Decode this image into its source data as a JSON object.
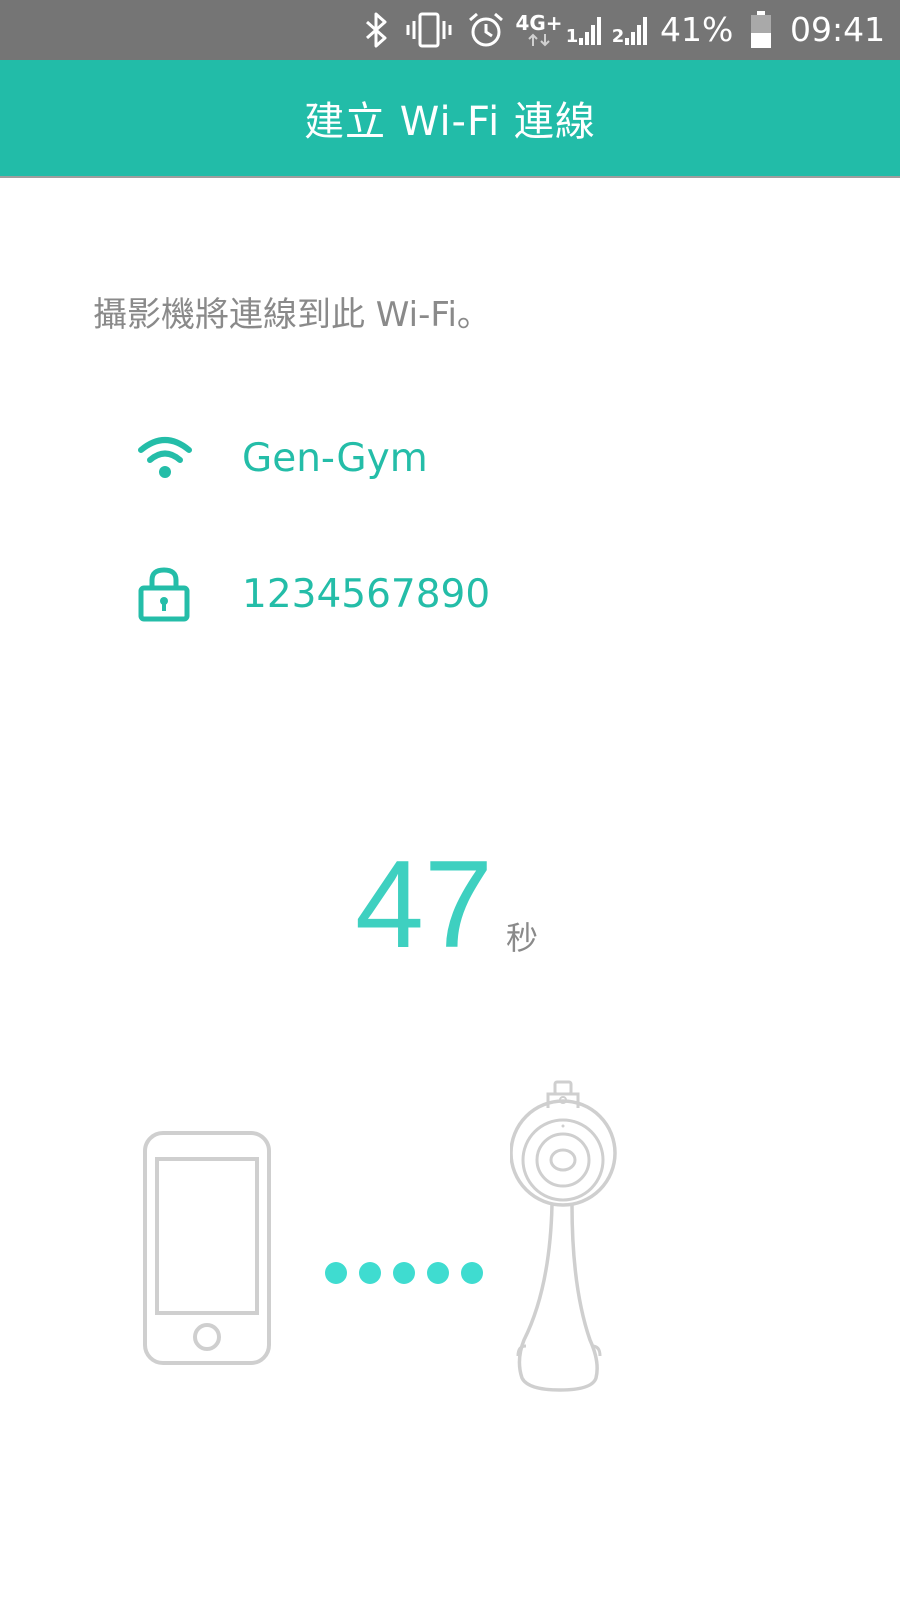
{
  "status_bar": {
    "battery_percent": "41%",
    "time": "09:41",
    "network_type": "4G+",
    "sim1_label": "1",
    "sim2_label": "2",
    "icons": [
      "bluetooth-icon",
      "vibrate-icon",
      "alarm-icon",
      "network-4g-icon",
      "signal-sim1-icon",
      "signal-sim2-icon",
      "battery-icon"
    ]
  },
  "app_bar": {
    "title": "建立 Wi-Fi 連線"
  },
  "main": {
    "description": "攝影機將連線到此 Wi-Fi。",
    "network_name": "Gen-Gym",
    "network_password": "1234567890",
    "countdown_value": "47",
    "countdown_unit": "秒"
  },
  "illustration": {
    "left_device": "phone-icon",
    "right_device": "camera-icon",
    "dot_count": 5
  },
  "colors": {
    "accent": "#24bda8",
    "accent_light": "#3ed0c0",
    "app_bar": "#22bca8",
    "status_bar": "#757575",
    "muted_text": "#8a8a8a",
    "illustration_gray": "#cfcfcf",
    "dots": "#3fdcd0"
  }
}
